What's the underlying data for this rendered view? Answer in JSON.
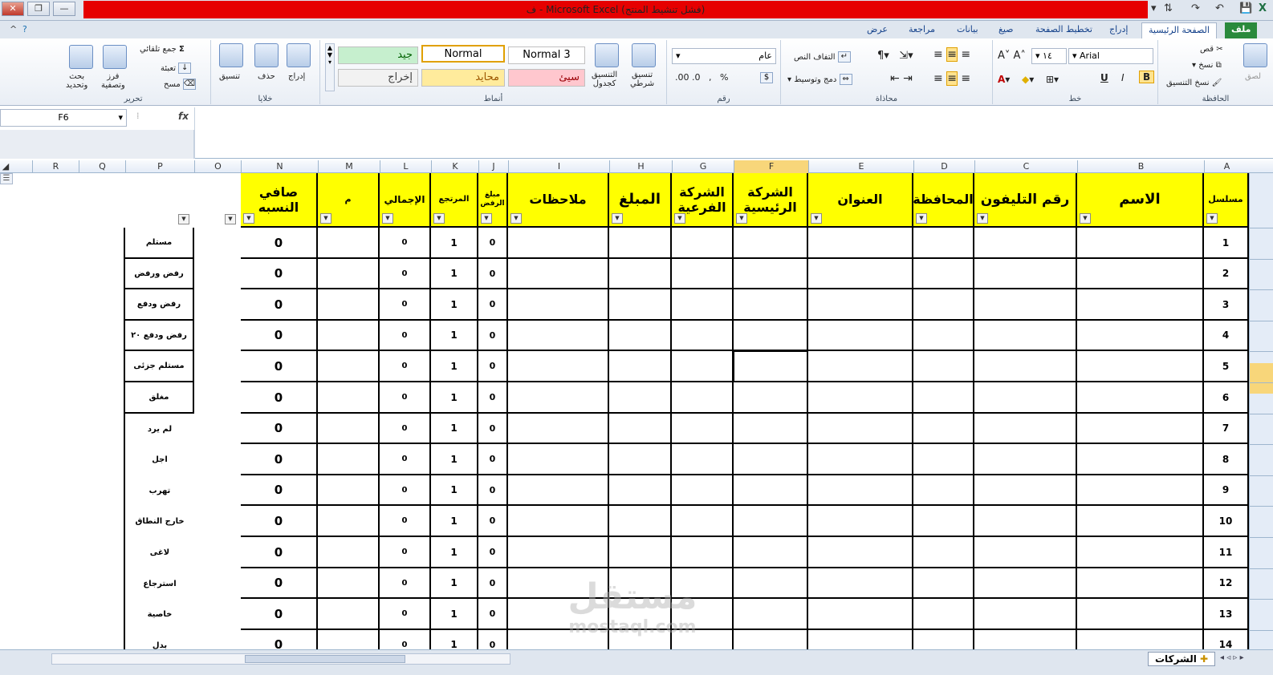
{
  "window": {
    "title": "ف - Microsoft Excel (فشل تنشيط المنتج)",
    "qat_icons": [
      "save-icon",
      "undo-icon",
      "redo-icon",
      "sort-icon",
      "customize-qat-icon"
    ]
  },
  "tabs": [
    "ملف",
    "الصفحة الرئيسية",
    "إدراج",
    "تخطيط الصفحة",
    "صيغ",
    "بيانات",
    "مراجعة",
    "عرض"
  ],
  "active_tab": "الصفحة الرئيسية",
  "ribbon": {
    "clipboard": {
      "label": "الحافظة",
      "cut": "قص",
      "copy": "نسخ",
      "format_painter": "نسخ التنسيق",
      "paste": "لصق"
    },
    "font": {
      "label": "خط",
      "font_name": "Arial",
      "font_size": "١٤",
      "bold": "B",
      "italic": "I",
      "underline": "U"
    },
    "alignment": {
      "label": "محاذاة",
      "wrap": "التفاف النص",
      "merge": "دمج وتوسيط"
    },
    "number": {
      "label": "رقم",
      "format": "عام"
    },
    "styles": {
      "label": "أنماط",
      "conditional": [
        "تنسيق",
        "شرطي"
      ],
      "as_table": [
        "التنسيق",
        "كجدول"
      ],
      "cell_styles": [
        {
          "text": "Normal 3",
          "bg": "#ffffff",
          "color": "#000000"
        },
        {
          "text": "Normal",
          "bg": "#ffffff",
          "color": "#000000"
        },
        {
          "text": "جيد",
          "bg": "#c6efce",
          "color": "#006100"
        },
        {
          "text": "سيئ",
          "bg": "#ffc7ce",
          "color": "#9c0006"
        },
        {
          "text": "محايد",
          "bg": "#ffeb9c",
          "color": "#9c5700"
        },
        {
          "text": "إخراج",
          "bg": "#f2f2f2",
          "color": "#3f3f3f"
        }
      ]
    },
    "cells": {
      "label": "خلايا",
      "insert": "إدراج",
      "delete": "حذف",
      "format": "تنسيق"
    },
    "editing": {
      "label": "تحرير",
      "autosum": "جمع تلقائي",
      "fill": "تعبئة",
      "clear": "مسح",
      "sort": [
        "فرز",
        "وتصفية"
      ],
      "find": [
        "بحث",
        "وتحديد"
      ]
    }
  },
  "formula_bar": {
    "name_box": "F6",
    "fx": "fx",
    "content": ""
  },
  "columns": [
    "A",
    "B",
    "C",
    "D",
    "E",
    "F",
    "G",
    "H",
    "I",
    "J",
    "K",
    "L",
    "M",
    "N",
    "O",
    "P",
    "Q",
    "R"
  ],
  "selected_column": "F",
  "selected_row": "5",
  "headers": {
    "A": "مسلسل",
    "B": "الاسم",
    "C": "رقم التليفون",
    "D": "المحافظة",
    "E": "العنوان",
    "F": "الشركة الرئيسية",
    "G": "الشركة الفرعية",
    "H": "المبلغ",
    "I": "ملاحظات",
    "J": "مبلغ الرفض",
    "K": "المرتجع",
    "L": "الإجمالي",
    "M": "م",
    "N": "صافي النسبه"
  },
  "rows": [
    {
      "a": "1",
      "j": "0",
      "k": "1",
      "l": "0",
      "n": "0",
      "p": "مستلم"
    },
    {
      "a": "2",
      "j": "0",
      "k": "1",
      "l": "0",
      "n": "0",
      "p": "رفض ورفض"
    },
    {
      "a": "3",
      "j": "0",
      "k": "1",
      "l": "0",
      "n": "0",
      "p": "رفض ودفع"
    },
    {
      "a": "4",
      "j": "0",
      "k": "1",
      "l": "0",
      "n": "0",
      "p": "رفض ودفع ٢٠"
    },
    {
      "a": "5",
      "j": "0",
      "k": "1",
      "l": "0",
      "n": "0",
      "p": "مستلم جزئى"
    },
    {
      "a": "6",
      "j": "0",
      "k": "1",
      "l": "0",
      "n": "0",
      "p": "مغلق"
    },
    {
      "a": "7",
      "j": "0",
      "k": "1",
      "l": "0",
      "n": "0",
      "p": "لم يرد"
    },
    {
      "a": "8",
      "j": "0",
      "k": "1",
      "l": "0",
      "n": "0",
      "p": "اجل"
    },
    {
      "a": "9",
      "j": "0",
      "k": "1",
      "l": "0",
      "n": "0",
      "p": "تهرب"
    },
    {
      "a": "10",
      "j": "0",
      "k": "1",
      "l": "0",
      "n": "0",
      "p": "خارج النطاق"
    },
    {
      "a": "11",
      "j": "0",
      "k": "1",
      "l": "0",
      "n": "0",
      "p": "لاغى"
    },
    {
      "a": "12",
      "j": "0",
      "k": "1",
      "l": "0",
      "n": "0",
      "p": "استرجاع"
    },
    {
      "a": "13",
      "j": "0",
      "k": "1",
      "l": "0",
      "n": "0",
      "p": "خاصية"
    },
    {
      "a": "14",
      "j": "0",
      "k": "1",
      "l": "0",
      "n": "0",
      "p": "بدل"
    }
  ],
  "sheet_tab": "الشركات",
  "watermark": {
    "brand": "مستقل",
    "site": "mostaql.com"
  }
}
